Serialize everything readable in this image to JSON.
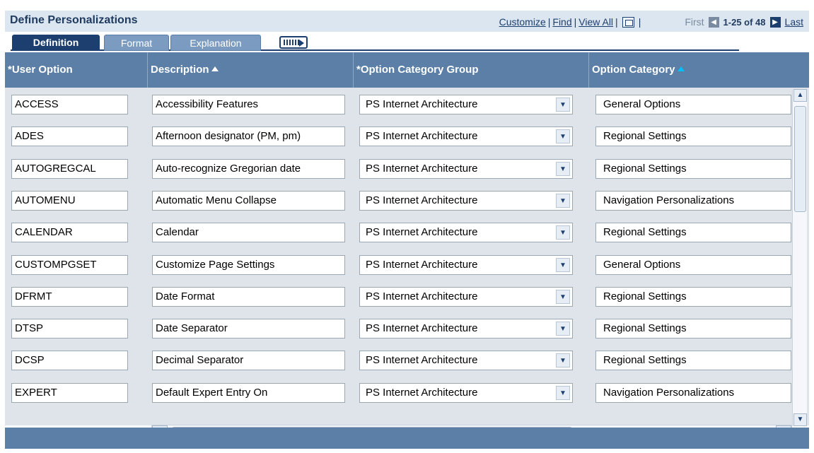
{
  "title": "Define Personalizations",
  "nav": {
    "customize": "Customize",
    "find": "Find",
    "view_all": "View All",
    "first": "First",
    "range": "1-25 of 48",
    "last": "Last"
  },
  "tabs": [
    "Definition",
    "Format",
    "Explanation"
  ],
  "columns": [
    "*User Option",
    "Description",
    "*Option Category Group",
    "Option Category"
  ],
  "rows": [
    {
      "option": "ACCESS",
      "description": "Accessibility Features",
      "group": "PS Internet Architecture",
      "category": "General Options"
    },
    {
      "option": "ADES",
      "description": "Afternoon designator (PM, pm)",
      "group": "PS Internet Architecture",
      "category": "Regional Settings"
    },
    {
      "option": "AUTOGREGCAL",
      "description": "Auto-recognize Gregorian date",
      "group": "PS Internet Architecture",
      "category": "Regional Settings"
    },
    {
      "option": "AUTOMENU",
      "description": "Automatic Menu Collapse",
      "group": "PS Internet Architecture",
      "category": "Navigation Personalizations"
    },
    {
      "option": "CALENDAR",
      "description": "Calendar",
      "group": "PS Internet Architecture",
      "category": "Regional Settings"
    },
    {
      "option": "CUSTOMPGSET",
      "description": "Customize Page Settings",
      "group": "PS Internet Architecture",
      "category": "General Options"
    },
    {
      "option": "DFRMT",
      "description": "Date Format",
      "group": "PS Internet Architecture",
      "category": "Regional Settings"
    },
    {
      "option": "DTSP",
      "description": "Date Separator",
      "group": "PS Internet Architecture",
      "category": "Regional Settings"
    },
    {
      "option": "DCSP",
      "description": "Decimal Separator",
      "group": "PS Internet Architecture",
      "category": "Regional Settings"
    },
    {
      "option": "EXPERT",
      "description": "Default Expert Entry On",
      "group": "PS Internet Architecture",
      "category": "Navigation Personalizations"
    }
  ]
}
